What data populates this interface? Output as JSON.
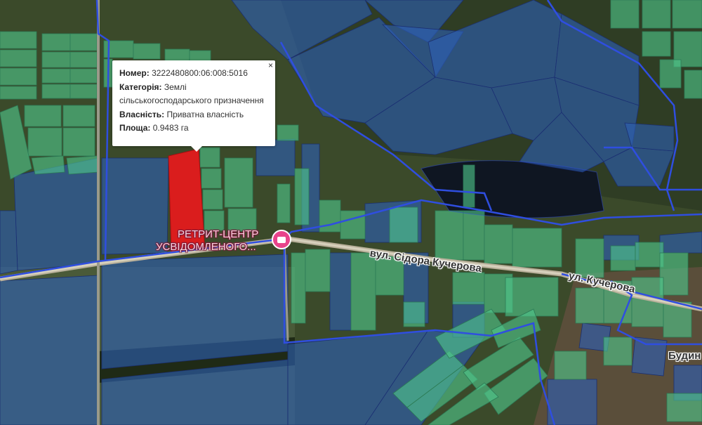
{
  "popup": {
    "number_label": "Номер:",
    "number_value": "3222480800:06:008:5016",
    "category_label": "Категорія:",
    "category_value_line1": "Землі",
    "category_value_line2": "сільськогосподарського призначення",
    "ownership_label": "Власність:",
    "ownership_value": "Приватна власність",
    "area_label": "Площа:",
    "area_value": "0.9483 га",
    "close_glyph": "×"
  },
  "poi": {
    "name_line1": "РЕТРИТ-ЦЕНТР",
    "name_line2": "УСВІДОМЛЕНОГО...",
    "icon": "bed-icon"
  },
  "streets": {
    "street1": "вул. Сідора Кучерова",
    "street2": "ул. Кучерова",
    "place": "Будин"
  },
  "colors": {
    "selected_parcel": "#e31a1c",
    "green_parcel": "#4fc78a",
    "blue_parcel": "#2d5fb4",
    "boundary": "#2f4ee0"
  }
}
